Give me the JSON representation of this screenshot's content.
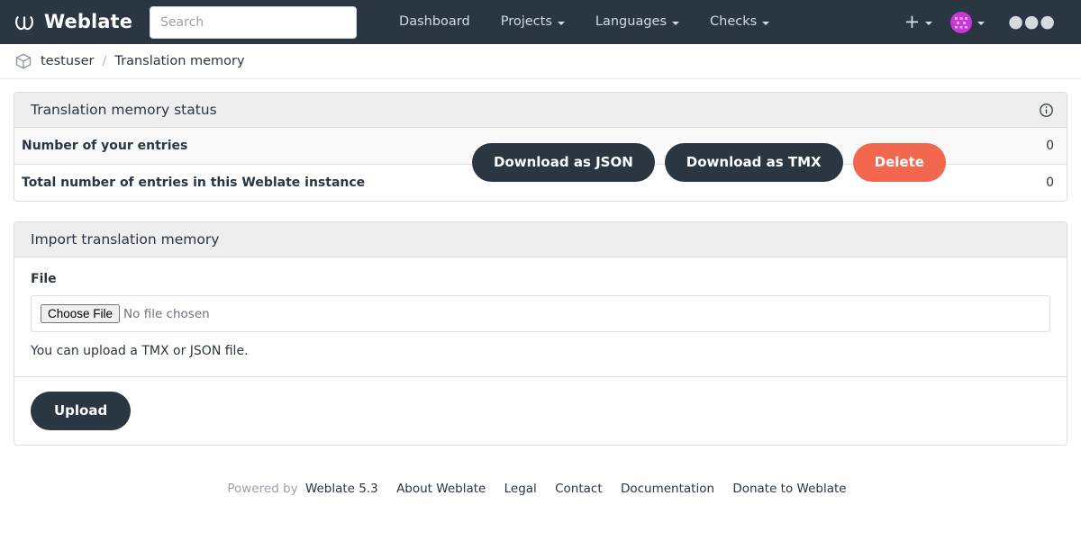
{
  "navbar": {
    "brand_name": "Weblate",
    "brand_logo_icon": "weblate-logo-icon",
    "search_placeholder": "Search",
    "search_value": "",
    "links": [
      {
        "label": "Dashboard",
        "has_caret": false
      },
      {
        "label": "Projects",
        "has_caret": true
      },
      {
        "label": "Languages",
        "has_caret": true
      },
      {
        "label": "Checks",
        "has_caret": true
      }
    ],
    "add_icon": "plus-icon",
    "avatar_icon": "user-avatar-identicon",
    "menu_icon": "ellipsis-horizontal-icon"
  },
  "breadcrumb": {
    "icon": "cube-box-icon",
    "user": "testuser",
    "separator": "/",
    "current": "Translation memory"
  },
  "status_panel": {
    "title": "Translation memory status",
    "info_icon": "info-circle-icon",
    "rows": [
      {
        "label": "Number of your entries",
        "value": "0"
      },
      {
        "label": "Total number of entries in this Weblate instance",
        "value": "0"
      }
    ],
    "actions": [
      {
        "label": "Download as JSON",
        "style": "dark"
      },
      {
        "label": "Download as TMX",
        "style": "dark"
      },
      {
        "label": "Delete",
        "style": "danger"
      }
    ]
  },
  "import_panel": {
    "title": "Import translation memory",
    "file_label": "File",
    "file_button_label": "Choose File",
    "file_status": "No file chosen",
    "help_text": "You can upload a TMX or JSON file.",
    "upload_label": "Upload"
  },
  "footer": {
    "powered_by": "Powered by",
    "version_link": "Weblate 5.3",
    "links": [
      "About Weblate",
      "Legal",
      "Contact",
      "Documentation",
      "Donate to Weblate"
    ]
  },
  "colors": {
    "navbar_bg": "#2a3642",
    "danger": "#f4674f",
    "panel_heading_bg": "#eeeeee",
    "avatar_accent": "#d63bd6"
  }
}
